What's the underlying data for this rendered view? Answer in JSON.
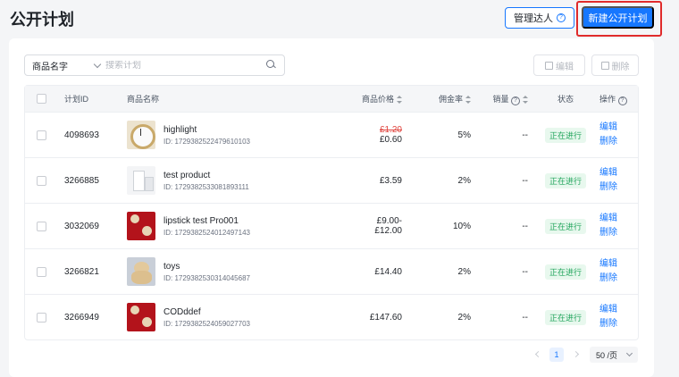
{
  "header": {
    "title": "公开计划",
    "manage_label": "管理达人",
    "new_plan_label": "新建公开计划"
  },
  "toolbar": {
    "search_field_select": "商品名字",
    "search_placeholder": "搜索计划",
    "edit_label": "编辑",
    "delete_label": "删除"
  },
  "table": {
    "columns": {
      "id": "计划ID",
      "name": "商品名称",
      "price": "商品价格",
      "commission": "佣金率",
      "sales": "销量",
      "status": "状态",
      "ops": "操作"
    },
    "rows": [
      {
        "id": "4098693",
        "name": "highlight",
        "pid": "ID: 1729382522479610103",
        "price_old": "£1.20",
        "price": "£0.60",
        "commission": "5%",
        "sales": "--",
        "status": "正在进行",
        "thumb": "clock",
        "edit": "编辑",
        "delete": "删除"
      },
      {
        "id": "3266885",
        "name": "test product",
        "pid": "ID: 1729382533081893111",
        "price_old": "",
        "price": "£3.59",
        "commission": "2%",
        "sales": "--",
        "status": "正在进行",
        "thumb": "box",
        "edit": "编辑",
        "delete": "删除"
      },
      {
        "id": "3032069",
        "name": "lipstick test Pro001",
        "pid": "ID: 1729382524012497143",
        "price_old": "£9.00-",
        "price": "£12.00",
        "commission": "10%",
        "sales": "--",
        "status": "正在进行",
        "thumb": "red",
        "edit": "编辑",
        "delete": "删除"
      },
      {
        "id": "3266821",
        "name": "toys",
        "pid": "ID: 1729382530314045687",
        "price_old": "",
        "price": "£14.40",
        "commission": "2%",
        "sales": "--",
        "status": "正在进行",
        "thumb": "bear",
        "edit": "编辑",
        "delete": "删除"
      },
      {
        "id": "3266949",
        "name": "CODddef",
        "pid": "ID: 1729382524059027703",
        "price_old": "",
        "price": "£147.60",
        "commission": "2%",
        "sales": "--",
        "status": "正在进行",
        "thumb": "red",
        "edit": "编辑",
        "delete": "删除"
      }
    ]
  },
  "pagination": {
    "current_page": "1",
    "page_size": "50 /页"
  },
  "colors": {
    "primary": "#1677ff",
    "status_green": "#1fa45a",
    "strike_red": "#e0453f",
    "highlight_red": "#e02b2b"
  }
}
